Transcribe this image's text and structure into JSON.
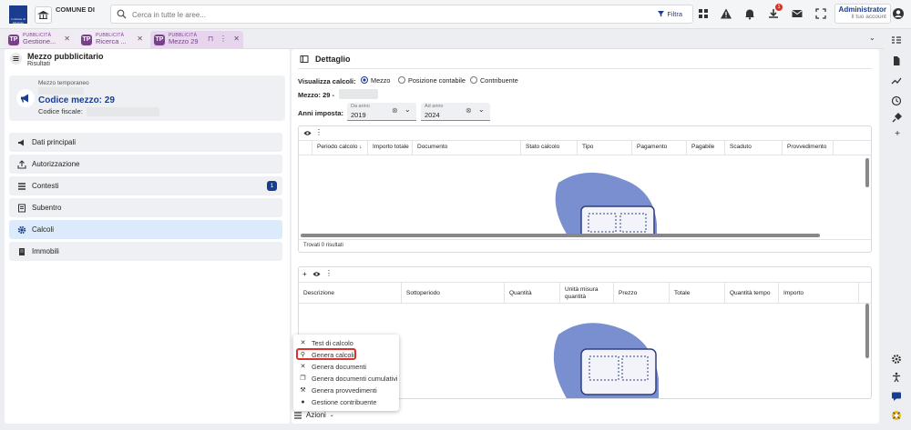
{
  "header": {
    "logo_text": "Comune di Mozzate",
    "comune_label": "COMUNE DI",
    "search_placeholder": "Cerca in tutte le aree...",
    "filter_label": "Filtra",
    "notification_count": "1",
    "user_name": "Administrator",
    "user_role": "Il tuo account",
    "icons": [
      "grid-icon",
      "warning-icon",
      "bell-icon",
      "download-icon",
      "mail-icon",
      "fullscreen-icon",
      "user-icon"
    ]
  },
  "tabs": [
    {
      "type": "PUBBLICITÀ",
      "title": "Gestione..."
    },
    {
      "type": "PUBBLICITÀ",
      "title": "Ricerca ..."
    },
    {
      "type": "PUBBLICITÀ",
      "title": "Mezzo 29"
    }
  ],
  "left": {
    "title": "Mezzo pubblicitario",
    "subtitle": "Risultati",
    "card": {
      "type_label": "Mezzo temporaneo",
      "code_title": "Codice mezzo: 29",
      "fiscal_label": "Codice fiscale:"
    },
    "menu": [
      {
        "label": "Dati principali",
        "icon": "megaphone-icon"
      },
      {
        "label": "Autorizzazione",
        "icon": "upload-icon"
      },
      {
        "label": "Contesti",
        "icon": "list-icon",
        "badge": "1"
      },
      {
        "label": "Subentro",
        "icon": "document-icon"
      },
      {
        "label": "Calcoli",
        "icon": "gear-icon"
      },
      {
        "label": "Immobili",
        "icon": "building-icon"
      }
    ]
  },
  "detail": {
    "title": "Dettaglio",
    "visualizza_label": "Visualizza calcoli:",
    "radio_options": [
      "Mezzo",
      "Posizione contabile",
      "Contribuente"
    ],
    "radio_selected": "Mezzo",
    "mezzo_label": "Mezzo: 29 -",
    "anni_label": "Anni imposta:",
    "da_anno_label": "Da anno",
    "da_anno_value": "2019",
    "ad_anno_label": "Ad anno",
    "ad_anno_value": "2024",
    "grid1": {
      "columns": [
        "Periodo calcolo",
        "Importo totale",
        "Documento",
        "Stato calcolo",
        "Tipo",
        "Pagamento",
        "Pagabile",
        "Scaduto",
        "Provvedimento"
      ],
      "footer": "Trovati 0 risultati"
    },
    "grid2": {
      "columns": [
        "Descrizione",
        "Sottoperiodo",
        "Quantità",
        "Unità misura quantità",
        "Prezzo",
        "Totale",
        "Quantità tempo",
        "Importo"
      ]
    }
  },
  "actions": {
    "button_label": "Azioni",
    "items": [
      {
        "label": "Test di calcolo",
        "icon": "tools-icon"
      },
      {
        "label": "Genera calcoli",
        "icon": "magic-icon"
      },
      {
        "label": "Genera documenti",
        "icon": "tools-icon"
      },
      {
        "label": "Genera documenti cumulativi",
        "icon": "copy-icon"
      },
      {
        "label": "Genera provvedimenti",
        "icon": "gavel-icon"
      },
      {
        "label": "Gestione contribuente",
        "icon": "person-icon"
      }
    ],
    "highlighted": "Genera calcoli",
    "highlight_color": "#d9342b"
  },
  "colors": {
    "accent": "#1b3d8f",
    "tab_purple": "#7b3f8f",
    "selected_menu": "#dcebfb"
  }
}
